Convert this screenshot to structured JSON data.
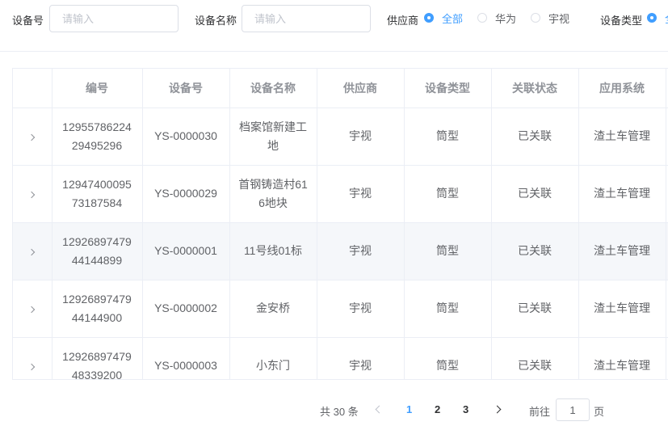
{
  "filters": {
    "device_no": {
      "label": "设备号",
      "placeholder": "请输入",
      "value": ""
    },
    "device_name": {
      "label": "设备名称",
      "placeholder": "请输入",
      "value": ""
    },
    "supplier": {
      "label": "供应商",
      "options": [
        "全部",
        "华为",
        "宇视"
      ],
      "selected": "全部"
    },
    "device_type": {
      "label": "设备类型",
      "options": [
        "全"
      ],
      "selected": "全"
    }
  },
  "table": {
    "columns": [
      "",
      "编号",
      "设备号",
      "设备名称",
      "供应商",
      "设备类型",
      "关联状态",
      "应用系统"
    ],
    "rows": [
      [
        "1295578622429495296",
        "YS-0000030",
        "档案馆新建工地",
        "宇视",
        "筒型",
        "已关联",
        "渣土车管理"
      ],
      [
        "1294740009573187584",
        "YS-0000029",
        "首钢铸造村616地块",
        "宇视",
        "筒型",
        "已关联",
        "渣土车管理"
      ],
      [
        "1292689747944144899",
        "YS-0000001",
        "11号线01标",
        "宇视",
        "筒型",
        "已关联",
        "渣土车管理"
      ],
      [
        "1292689747944144900",
        "YS-0000002",
        "金安桥",
        "宇视",
        "筒型",
        "已关联",
        "渣土车管理"
      ],
      [
        "1292689747948339200",
        "YS-0000003",
        "小东门",
        "宇视",
        "筒型",
        "已关联",
        "渣土车管理"
      ]
    ],
    "highlighted_row": 2
  },
  "pagination": {
    "total": "共 30 条",
    "pages": [
      "1",
      "2",
      "3"
    ],
    "current_page": "1",
    "goto_label": "前往",
    "goto_value": "1",
    "page_suffix": "页"
  },
  "colors": {
    "accent": "#409eff",
    "border": "#ebeef5",
    "header_text": "#909399",
    "row_highlight": "#f5f7fa"
  }
}
